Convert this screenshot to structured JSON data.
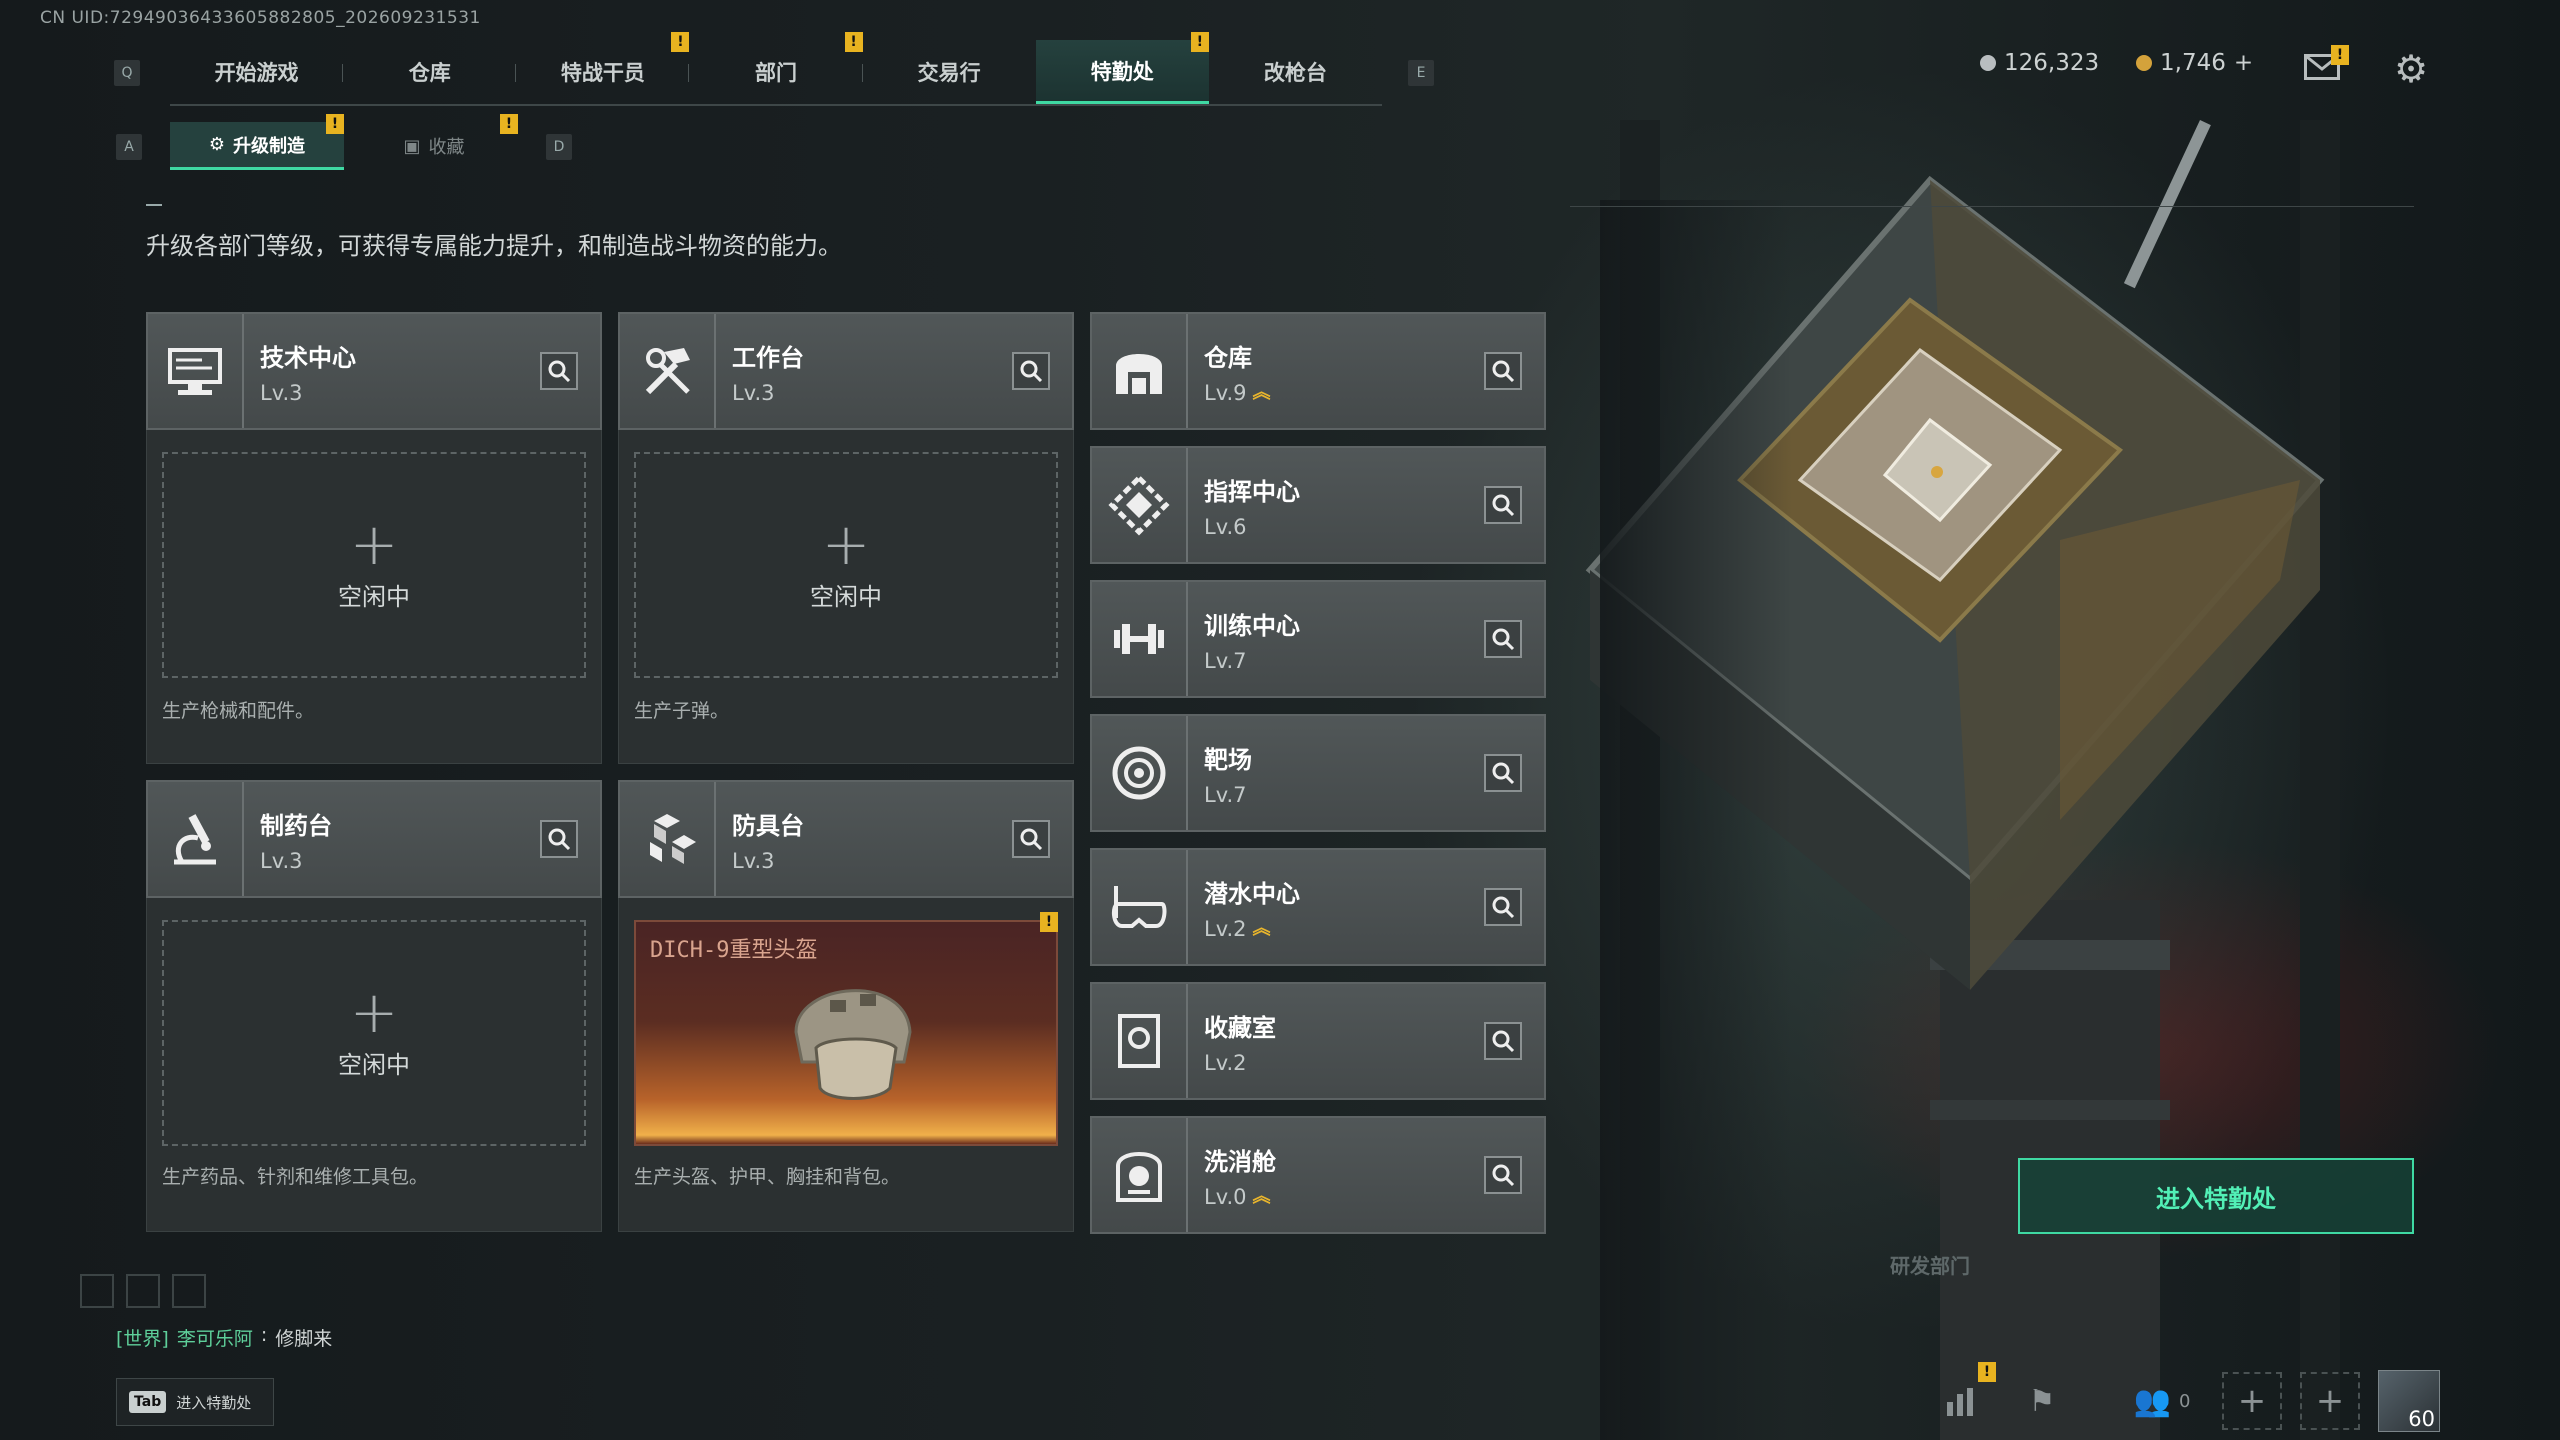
{
  "uid": "CN UID:72949036433605882805_202609231531",
  "keys": {
    "q": "Q",
    "e": "E",
    "a": "A",
    "d": "D"
  },
  "tabs": [
    "开始游戏",
    "仓库",
    "特战干员",
    "部门",
    "交易行",
    "特勤处",
    "改枪台"
  ],
  "active_tab": "特勤处",
  "badges": {
    "mark": "!"
  },
  "subtabs": {
    "craft": "升级制造",
    "collect": "收藏"
  },
  "currency": {
    "silver": "126,323",
    "gold": "1,746",
    "plus": "+"
  },
  "description": "升级各部门等级，可获得专属能力提升，和制造战斗物资的能力。",
  "stations": [
    {
      "name": "技术中心",
      "level": "Lv.3",
      "icon": "monitor-icon",
      "slot": "空闲中",
      "note": "生产枪械和配件。"
    },
    {
      "name": "工作台",
      "level": "Lv.3",
      "icon": "tools-icon",
      "slot": "空闲中",
      "note": "生产子弹。"
    },
    {
      "name": "制药台",
      "level": "Lv.3",
      "icon": "microscope-icon",
      "slot": "空闲中",
      "note": "生产药品、针剂和维修工具包。"
    },
    {
      "name": "防具台",
      "level": "Lv.3",
      "icon": "boxes-icon",
      "product": "DICH-9重型头盔",
      "note": "生产头盔、护甲、胸挂和背包。"
    }
  ],
  "departments": [
    {
      "name": "仓库",
      "level": "Lv.9",
      "upgrade": true,
      "icon": "vault-icon"
    },
    {
      "name": "指挥中心",
      "level": "Lv.6",
      "upgrade": false,
      "icon": "command-icon"
    },
    {
      "name": "训练中心",
      "level": "Lv.7",
      "upgrade": false,
      "icon": "dumbbell-icon"
    },
    {
      "name": "靶场",
      "level": "Lv.7",
      "upgrade": false,
      "icon": "target-icon"
    },
    {
      "name": "潜水中心",
      "level": "Lv.2",
      "upgrade": true,
      "icon": "diving-mask-icon"
    },
    {
      "name": "收藏室",
      "level": "Lv.2",
      "upgrade": false,
      "icon": "collection-icon"
    },
    {
      "name": "洗消舱",
      "level": "Lv.0",
      "upgrade": true,
      "icon": "hazmat-icon"
    }
  ],
  "enter_button": "进入特勤处",
  "chat": {
    "channel": "[世界]",
    "user": "李可乐阿",
    "message": "修脚来"
  },
  "tab_hint": {
    "key": "Tab",
    "label": "进入特勤处"
  },
  "footer": {
    "friends": "0",
    "level": "60"
  },
  "sign": "研发部门"
}
